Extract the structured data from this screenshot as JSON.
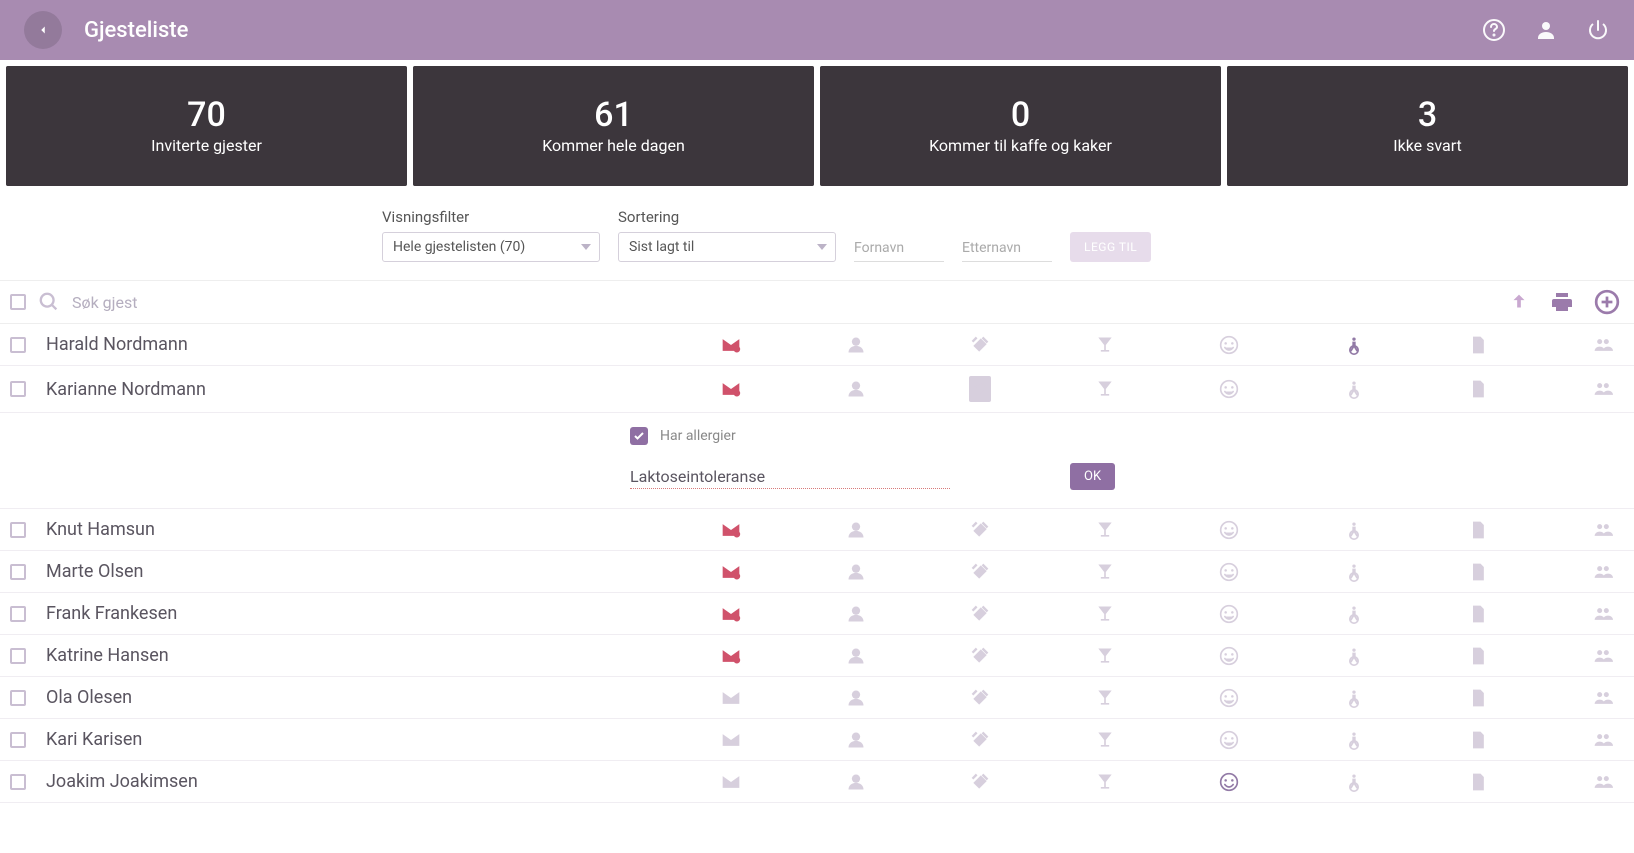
{
  "header": {
    "title": "Gjesteliste"
  },
  "stats": [
    {
      "value": "70",
      "label": "Inviterte gjester"
    },
    {
      "value": "61",
      "label": "Kommer hele dagen"
    },
    {
      "value": "0",
      "label": "Kommer til kaffe og kaker"
    },
    {
      "value": "3",
      "label": "Ikke svart"
    }
  ],
  "filters": {
    "display_label": "Visningsfilter",
    "display_value": "Hele gjestelisten (70)",
    "sort_label": "Sortering",
    "sort_value": "Sist lagt til",
    "firstname_placeholder": "Fornavn",
    "lastname_placeholder": "Etternavn",
    "add_button": "LEGG TIL"
  },
  "search": {
    "placeholder": "Søk gjest"
  },
  "expanded": {
    "has_allergies_label": "Har allergier",
    "allergy_value": "Laktoseintoleranse",
    "ok_button": "OK"
  },
  "guests": [
    {
      "name": "Harald Nordmann",
      "mail": "red",
      "access_active": true,
      "expanded": false,
      "food_highlight": false,
      "face_active": false
    },
    {
      "name": "Karianne Nordmann",
      "mail": "red",
      "access_active": false,
      "expanded": true,
      "food_highlight": true,
      "face_active": false
    },
    {
      "name": "Knut Hamsun",
      "mail": "red",
      "access_active": false,
      "expanded": false,
      "food_highlight": false,
      "face_active": false
    },
    {
      "name": "Marte Olsen",
      "mail": "red",
      "access_active": false,
      "expanded": false,
      "food_highlight": false,
      "face_active": false
    },
    {
      "name": "Frank Frankesen",
      "mail": "red",
      "access_active": false,
      "expanded": false,
      "food_highlight": false,
      "face_active": false
    },
    {
      "name": "Katrine Hansen",
      "mail": "red",
      "access_active": false,
      "expanded": false,
      "food_highlight": false,
      "face_active": false
    },
    {
      "name": "Ola Olesen",
      "mail": "mute",
      "access_active": false,
      "expanded": false,
      "food_highlight": false,
      "face_active": false
    },
    {
      "name": "Kari Karisen",
      "mail": "mute",
      "access_active": false,
      "expanded": false,
      "food_highlight": false,
      "face_active": false
    },
    {
      "name": "Joakim Joakimsen",
      "mail": "mute",
      "access_active": false,
      "expanded": false,
      "food_highlight": false,
      "face_active": true
    }
  ]
}
